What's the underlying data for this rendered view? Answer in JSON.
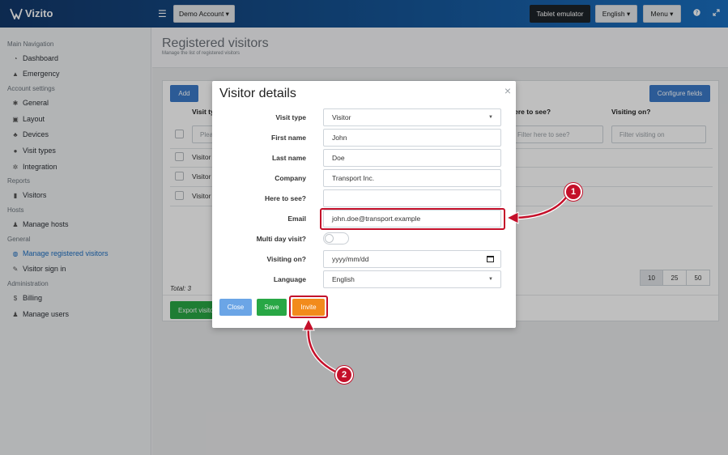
{
  "app": {
    "name": "Vizito"
  },
  "topbar": {
    "account_label": "Demo Account ▾",
    "tablet_label": "Tablet emulator",
    "language_label": "English ▾",
    "menu_label": "Menu ▾",
    "help_icon": "question-icon",
    "expand_icon": "expand-icon"
  },
  "sidebar": {
    "sections": [
      {
        "title": "Main Navigation",
        "items": [
          {
            "label": "Dashboard",
            "icon": "gauge-icon"
          },
          {
            "label": "Emergency",
            "icon": "warning-icon"
          }
        ]
      },
      {
        "title": "Account settings",
        "items": [
          {
            "label": "General",
            "icon": "gear-icon"
          },
          {
            "label": "Layout",
            "icon": "image-icon"
          },
          {
            "label": "Devices",
            "icon": "sitemap-icon"
          },
          {
            "label": "Visit types",
            "icon": "users-icon"
          },
          {
            "label": "Integration",
            "icon": "gears-icon"
          }
        ]
      },
      {
        "title": "Reports",
        "items": [
          {
            "label": "Visitors",
            "icon": "book-icon"
          }
        ]
      },
      {
        "title": "Hosts",
        "items": [
          {
            "label": "Manage hosts",
            "icon": "person-icon"
          }
        ]
      },
      {
        "title": "General",
        "items": [
          {
            "label": "Manage registered visitors",
            "icon": "globe-icon",
            "active": true
          },
          {
            "label": "Visitor sign in",
            "icon": "pencil-icon"
          }
        ]
      },
      {
        "title": "Administration",
        "items": [
          {
            "label": "Billing",
            "icon": "dollar-icon"
          },
          {
            "label": "Manage users",
            "icon": "user-plus-icon"
          }
        ]
      }
    ]
  },
  "page": {
    "title": "Registered visitors",
    "subtitle": "Manage the list of registered visitors",
    "add_label": "Add",
    "configure_label": "Configure fields",
    "columns": [
      "Visit type",
      "Here to see?",
      "Visiting on?"
    ],
    "filters": {
      "visit_type": "Plea",
      "here_to_see": "Filter here to see?",
      "visiting_on": "Filter visiting on"
    },
    "rows": [
      "Visitor",
      "Visitor",
      "Visitor"
    ],
    "page_sizes": [
      "10",
      "25",
      "50"
    ],
    "total": "Total: 3",
    "export_label": "Export visito"
  },
  "modal": {
    "title": "Visitor details",
    "close_symbol": "×",
    "fields": {
      "visit_type": {
        "label": "Visit type",
        "value": "Visitor"
      },
      "first_name": {
        "label": "First name",
        "value": "John"
      },
      "last_name": {
        "label": "Last name",
        "value": "Doe"
      },
      "company": {
        "label": "Company",
        "value": "Transport Inc."
      },
      "here_to_see": {
        "label": "Here to see?",
        "value": ""
      },
      "email": {
        "label": "Email",
        "value": "john.doe@transport.example"
      },
      "multi_day": {
        "label": "Multi day visit?",
        "checked": false
      },
      "visiting_on": {
        "label": "Visiting on?",
        "placeholder": "yyyy/mm/dd"
      },
      "language": {
        "label": "Language",
        "value": "English"
      }
    },
    "buttons": {
      "close": "Close",
      "save": "Save",
      "invite": "Invite"
    }
  },
  "annotations": {
    "step1": "1",
    "step2": "2"
  },
  "colors": {
    "accent": "#1b6ec2",
    "highlight": "#c4102a",
    "invite": "#f28b1c",
    "save": "#28a745",
    "close": "#6ba5e6"
  }
}
